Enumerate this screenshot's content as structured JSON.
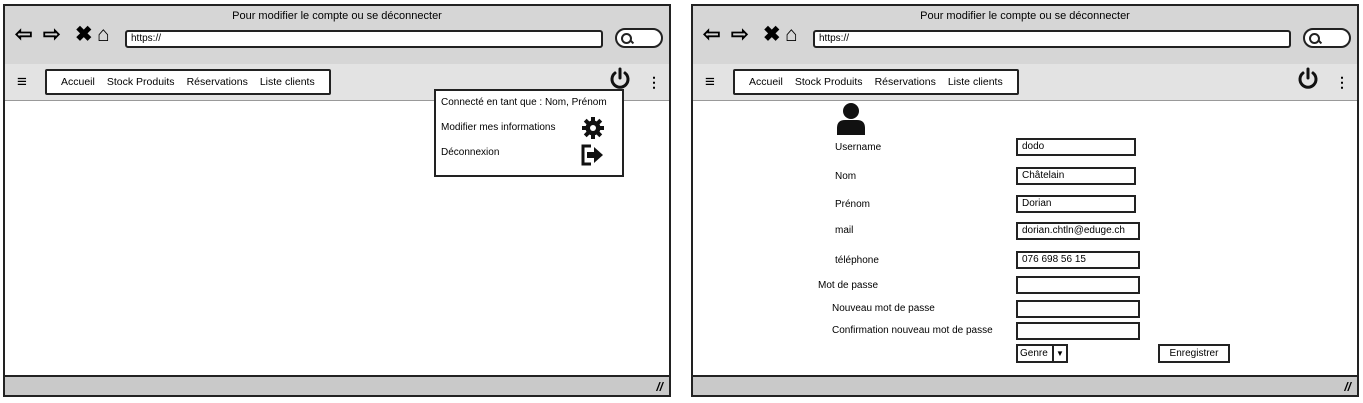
{
  "left_window": {
    "title": "Pour modifier le compte ou se déconnecter",
    "url": "https://",
    "nav_items": [
      "Accueil",
      "Stock Produits",
      "Réservations",
      "Liste clients"
    ],
    "dropdown": {
      "connected_as": "Connecté en tant que : Nom, Prénom",
      "edit_info": "Modifier mes informations",
      "logout": "Déconnexion"
    }
  },
  "right_window": {
    "title": "Pour modifier le compte ou se déconnecter",
    "url": "https://",
    "nav_items": [
      "Accueil",
      "Stock Produits",
      "Réservations",
      "Liste clients"
    ],
    "form": {
      "username_label": "Username",
      "username_value": "dodo",
      "nom_label": "Nom",
      "nom_value": "Châtelain",
      "prenom_label": "Prénom",
      "prenom_value": "Dorian",
      "mail_label": "mail",
      "mail_value": "dorian.chtln@eduge.ch",
      "telephone_label": "téléphone",
      "telephone_value": "076 698 56 15",
      "password_label": "Mot de passe",
      "new_password_label": "Nouveau mot de passe",
      "confirm_password_label": "Confirmation nouveau mot de passe",
      "genre_label": "Genre",
      "save_label": "Enregistrer"
    }
  },
  "icons": [
    "back-arrow-icon",
    "forward-arrow-icon",
    "close-icon",
    "home-icon",
    "search-icon",
    "menu-icon",
    "power-icon",
    "more-options-icon",
    "gear-icon",
    "logout-icon",
    "user-avatar-icon",
    "resize-grip-icon",
    "dropdown-arrow-icon"
  ]
}
